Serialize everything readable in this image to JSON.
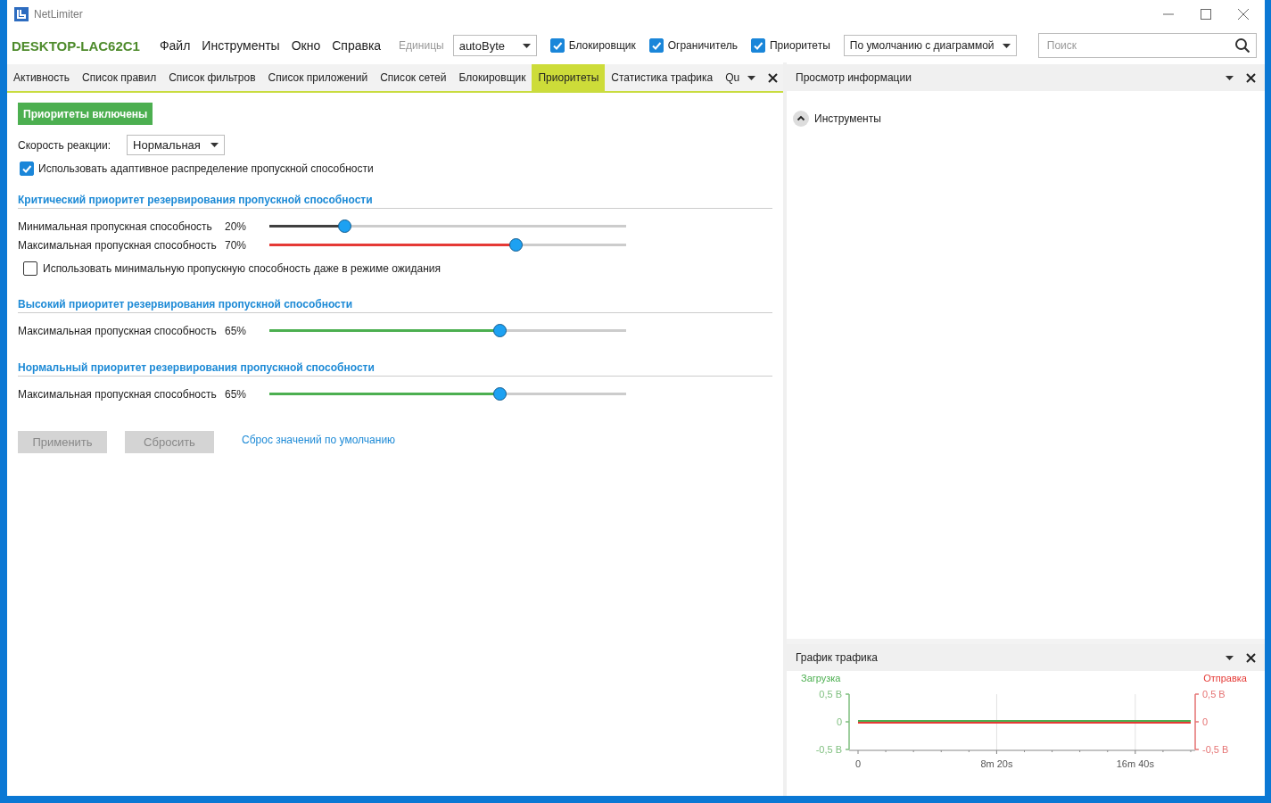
{
  "window": {
    "title": "NetLimiter"
  },
  "toolbar": {
    "host": "DESKTOP-LAC62C1",
    "menu": [
      "Файл",
      "Инструменты",
      "Окно",
      "Справка"
    ],
    "units_label": "Единицы",
    "units_value": "autoByte",
    "toggles": [
      {
        "label": "Блокировщик",
        "checked": true
      },
      {
        "label": "Ограничитель",
        "checked": true
      },
      {
        "label": "Приоритеты",
        "checked": true
      }
    ],
    "view_value": "По умолчанию с диаграммой",
    "search": {
      "placeholder": "Поиск"
    }
  },
  "tabs": [
    {
      "label": "Активность",
      "selected": false
    },
    {
      "label": "Список правил",
      "selected": false
    },
    {
      "label": "Список фильтров",
      "selected": false
    },
    {
      "label": "Список приложений",
      "selected": false
    },
    {
      "label": "Список сетей",
      "selected": false
    },
    {
      "label": "Блокировщик",
      "selected": false
    },
    {
      "label": "Приоритеты",
      "selected": true
    },
    {
      "label": "Статистика трафика",
      "selected": false
    },
    {
      "label": "Qu",
      "selected": false
    }
  ],
  "priorities": {
    "status_button": "Приоритеты включены",
    "reaction_label": "Скорость реакции:",
    "reaction_value": "Нормальная",
    "adaptive": {
      "label": "Использовать адаптивное распределение пропускной способности",
      "checked": true
    },
    "groups": [
      {
        "title": "Критический приоритет резервирования пропускной способности",
        "sliders": [
          {
            "label": "Минимальная пропускная способность",
            "reading": "20%",
            "level": 0.21,
            "color": "#404040"
          },
          {
            "label": "Максимальная пропускная способность",
            "reading": "70%",
            "level": 0.69,
            "color": "#e53935"
          }
        ],
        "idle_option": {
          "label": "Использовать минимальную пропускную способность даже в режиме ожидания",
          "checked": false
        }
      },
      {
        "title": "Высокий приоритет резервирования пропускной способности",
        "sliders": [
          {
            "label": "Максимальная пропускная способность",
            "reading": "65%",
            "level": 0.645,
            "color": "#4caf50"
          }
        ]
      },
      {
        "title": "Нормальный приоритет резервирования пропускной способности",
        "sliders": [
          {
            "label": "Максимальная пропускная способность",
            "reading": "65%",
            "level": 0.645,
            "color": "#4caf50"
          }
        ]
      }
    ],
    "buttons": [
      {
        "label": "Применить",
        "disabled": true
      },
      {
        "label": "Сбросить",
        "disabled": true
      }
    ],
    "reset_link": "Сброс значений по умолчанию"
  },
  "info_panel": {
    "title": "Просмотр информации",
    "sections": [
      {
        "label": "Инструменты",
        "expanded": true
      }
    ]
  },
  "graph_panel": {
    "title": "График трафика",
    "chart_data": {
      "type": "line",
      "categories": [
        "0",
        null,
        null,
        null,
        null,
        "8m 20s",
        null,
        null,
        null,
        null,
        "16m 40s",
        null,
        null
      ],
      "ylim": [
        -0.5,
        0.5
      ],
      "yticks": [
        {
          "value": 0.5,
          "label": "0,5 B"
        },
        {
          "value": 0,
          "label": "0"
        },
        {
          "value": -0.5,
          "label": "-0,5 B"
        }
      ],
      "series": [
        {
          "name": "Загрузка",
          "color": "#4caf50",
          "values": [
            0,
            0,
            0,
            0,
            0,
            0,
            0,
            0,
            0,
            0,
            0,
            0,
            0
          ]
        },
        {
          "name": "Отправка",
          "color": "#e53935",
          "values": [
            0,
            0,
            0,
            0,
            0,
            0,
            0,
            0,
            0,
            0,
            0,
            0,
            0
          ]
        }
      ]
    }
  }
}
